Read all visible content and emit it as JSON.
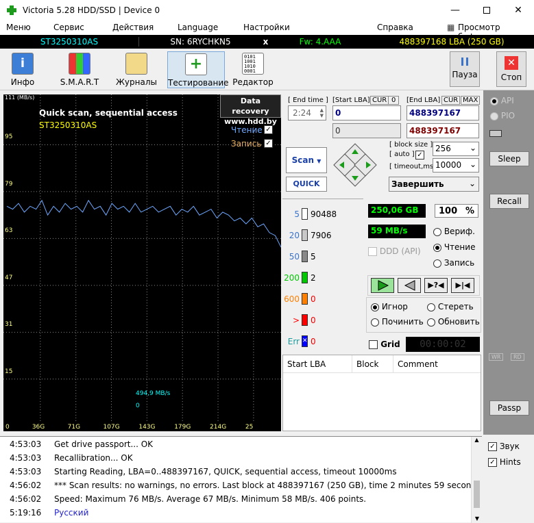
{
  "window": {
    "title": "Victoria 5.28 HDD/SSD | Device 0"
  },
  "menu": [
    "Меню",
    "Сервис",
    "Действия",
    "Language",
    "Настройки",
    "Справка"
  ],
  "menu_buffer": "Просмотр буфера",
  "info": {
    "model": "ST3250310AS",
    "serial": "SN: 6RYCHKN5",
    "x": "x",
    "fw": "Fw: 4.AAA",
    "lba": "488397168 LBA (250 GB)"
  },
  "toolbar": {
    "info": "Инфо",
    "smart": "S.M.A.R.T",
    "logs": "Журналы",
    "test": "Тестирование",
    "editor": "Редактор",
    "pause": "Пауза",
    "stop": "Стоп"
  },
  "graph": {
    "title": "Quick scan, sequential access",
    "model": "ST3250310AS",
    "recovery1": "Data recovery",
    "recovery2": "www.hdd.by",
    "read_label": "Чтение",
    "write_label": "Запись",
    "speed": "494,9 MB/s",
    "speed_zero": "0",
    "yunit": "111 (MB/s)",
    "yticks": [
      "95",
      "79",
      "63",
      "47",
      "31",
      "15"
    ],
    "xticks": [
      "0",
      "36G",
      "71G",
      "107G",
      "143G",
      "179G",
      "214G",
      "25"
    ],
    "read_color": "#6fa8ff",
    "write_color": "#e8b060"
  },
  "chart_data": {
    "type": "line",
    "ylabel": "(MB/s)",
    "ylim": [
      0,
      111
    ],
    "xlim": [
      0,
      250
    ],
    "series": [
      {
        "name": "Чтение",
        "values": [
          74,
          73,
          75,
          72,
          74,
          73,
          76,
          71,
          74,
          72,
          75,
          73,
          74,
          72,
          76,
          73,
          74,
          71,
          75,
          73,
          74,
          72,
          75,
          72,
          73,
          74,
          72,
          73,
          74,
          71,
          73,
          72,
          74,
          71,
          72,
          73,
          70,
          72,
          71,
          69,
          70,
          68,
          70,
          67,
          68,
          65,
          64,
          60
        ]
      }
    ]
  },
  "controls": {
    "end_time_label": "End time",
    "end_time": "2:24",
    "start_lba_label": "Start LBA",
    "cur": "CUR",
    "cur_val": "0",
    "end_lba_label": "End LBA",
    "max": "MAX",
    "start_lba": "0",
    "end_lba": "488397167",
    "start_lba2": "0",
    "end_lba2": "488397167",
    "block_size_label": "block size",
    "auto_label": "auto",
    "timeout_label": "timeout,ms",
    "block_size": "256",
    "timeout": "10000",
    "scan": "Scan",
    "quick": "QUICK",
    "finish": "Завершить"
  },
  "legend": [
    {
      "ms": "5",
      "count": "90488",
      "color": "#ffffff"
    },
    {
      "ms": "20",
      "count": "7906",
      "color": "#c8c8c8"
    },
    {
      "ms": "50",
      "count": "5",
      "color": "#888888"
    },
    {
      "ms": "200",
      "count": "2",
      "color": "#00c800"
    },
    {
      "ms": "600",
      "count": "0",
      "color": "#ff8000"
    },
    {
      "ms": ">",
      "count": "0",
      "color": "#ff0000"
    },
    {
      "ms": "Err",
      "count": "0",
      "color": "#0000ff"
    }
  ],
  "stats": {
    "gb": "250,06 GB",
    "pct": "100",
    "pct_sign": "%",
    "speed": "59 MB/s",
    "verify": "Вериф.",
    "read": "Чтение",
    "write": "Запись",
    "ddd": "DDD (API)",
    "ignore": "Игнор",
    "erase": "Стереть",
    "repair": "Починить",
    "refresh": "Обновить",
    "grid": "Grid",
    "timer": "00:00:02"
  },
  "table": {
    "headers": [
      "Start LBA",
      "Block",
      "Comment"
    ]
  },
  "right": {
    "api": "API",
    "pio": "PIO",
    "sleep": "Sleep",
    "recall": "Recall",
    "wr": "WR",
    "rd": "RD",
    "passp": "Passp",
    "sound": "Звук",
    "hints": "Hints"
  },
  "log": [
    {
      "t": "4:53:03",
      "m": "Get drive passport... OK"
    },
    {
      "t": "4:53:03",
      "m": "Recallibration... OK"
    },
    {
      "t": "4:53:03",
      "m": "Starting Reading, LBA=0..488397167, QUICK, sequential access, timeout 10000ms"
    },
    {
      "t": "4:56:02",
      "m": "*** Scan results: no warnings, no errors. Last block at 488397167 (250 GB), time 2 minutes 59 secon..."
    },
    {
      "t": "4:56:02",
      "m": "Speed: Maximum 76 MB/s. Average 67 MB/s. Minimum 58 MB/s. 406 points."
    },
    {
      "t": "5:19:16",
      "m": "Русский"
    }
  ]
}
